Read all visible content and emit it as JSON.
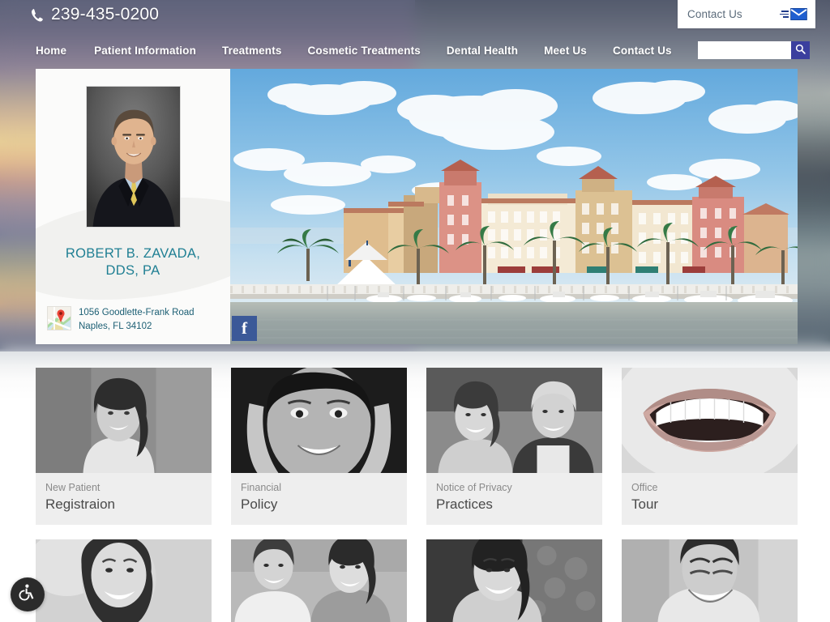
{
  "site": {
    "phone": "239-435-0200",
    "phone_icon": "phone-icon"
  },
  "header": {
    "contact_box": {
      "label": "Contact Us",
      "icon": "envelope-icon"
    }
  },
  "nav": {
    "items": [
      {
        "label": "Home"
      },
      {
        "label": "Patient Information"
      },
      {
        "label": "Treatments"
      },
      {
        "label": "Cosmetic Treatments"
      },
      {
        "label": "Dental Health"
      },
      {
        "label": "Meet Us"
      },
      {
        "label": "Contact Us"
      }
    ],
    "search": {
      "value": "",
      "placeholder": "",
      "icon": "search-icon"
    }
  },
  "doctor": {
    "photo_alt": "doctor-portrait",
    "name": "ROBERT B. ZAVADA,\nDDS, PA",
    "name_line1": "ROBERT B. ZAVADA,",
    "name_line2": "DDS, PA",
    "address_line1": "1056 Goodlette-Frank Road",
    "address_line2": "Naples, FL 34102",
    "map_icon": "google-maps-icon",
    "name_color": "#1f7f93",
    "address_color": "#1c5f74"
  },
  "hero": {
    "image_alt": "naples-waterfront-bayfront-buildings"
  },
  "social": {
    "facebook": {
      "label": "f",
      "icon": "facebook-icon",
      "color": "#3b5998"
    }
  },
  "cards_row1": [
    {
      "sub": "New Patient",
      "title": "Registraion",
      "image_alt": "smiling-woman-dark-hair"
    },
    {
      "sub": "Financial",
      "title": "Policy",
      "image_alt": "smiling-woman-hands-on-face"
    },
    {
      "sub": "Notice of Privacy",
      "title": "Practices",
      "image_alt": "laughing-mature-couple"
    },
    {
      "sub": "Office",
      "title": "Tour",
      "image_alt": "close-up-smile-teeth"
    }
  ],
  "cards_row2": [
    {
      "image_alt": "smiling-woman-portrait"
    },
    {
      "image_alt": "smiling-young-couple"
    },
    {
      "image_alt": "smiling-woman-long-hair"
    },
    {
      "image_alt": "laughing-man-portrait"
    }
  ],
  "accessibility": {
    "label": "Accessibility",
    "icon": "wheelchair-icon"
  },
  "colors": {
    "nav_text": "#ffffff",
    "search_button": "#3b3f9e",
    "card_bg": "#eeeeee",
    "card_sub": "#8a8a8a",
    "card_title": "#4a4a4a"
  }
}
